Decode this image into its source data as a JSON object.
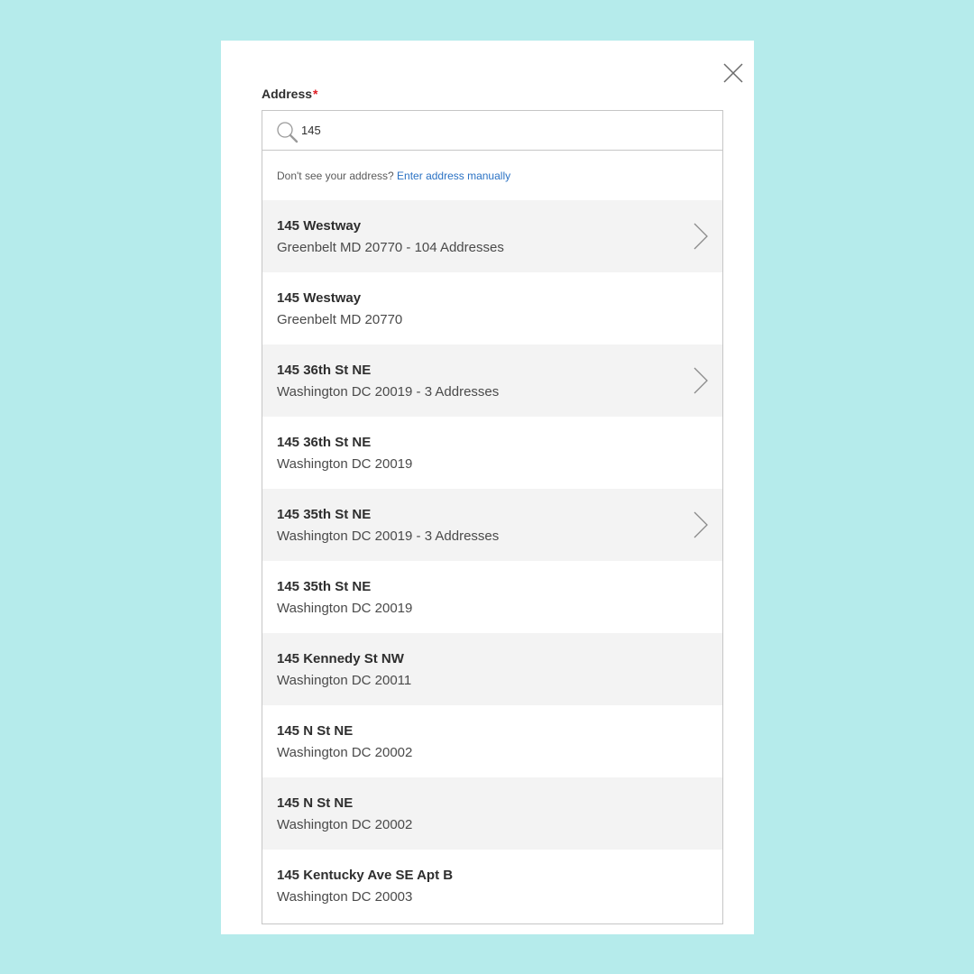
{
  "modal": {
    "field_label": "Address",
    "required_mark": "*",
    "search": {
      "icon": "search-icon",
      "value": "145"
    },
    "hint": {
      "text": "Don't see your address?",
      "link": "Enter address manually"
    },
    "colors": {
      "background": "#b5ebeb",
      "link": "#2a72c4",
      "required": "#de1c24",
      "row_shade": "#f3f3f3"
    },
    "results": [
      {
        "street": "145 Westway",
        "detail": "Greenbelt MD 20770 - 104 Addresses",
        "has_children": true
      },
      {
        "street": "145 Westway",
        "detail": "Greenbelt MD 20770",
        "has_children": false
      },
      {
        "street": "145 36th St NE",
        "detail": "Washington DC 20019 - 3 Addresses",
        "has_children": true
      },
      {
        "street": "145 36th St NE",
        "detail": "Washington DC 20019",
        "has_children": false
      },
      {
        "street": "145 35th St NE",
        "detail": "Washington DC 20019 - 3 Addresses",
        "has_children": true
      },
      {
        "street": "145 35th St NE",
        "detail": "Washington DC 20019",
        "has_children": false
      },
      {
        "street": "145 Kennedy St NW",
        "detail": "Washington DC 20011",
        "has_children": false
      },
      {
        "street": "145 N St NE",
        "detail": "Washington DC 20002",
        "has_children": false
      },
      {
        "street": "145 N St NE",
        "detail": "Washington DC 20002",
        "has_children": false
      },
      {
        "street": "145 Kentucky Ave SE Apt B",
        "detail": "Washington DC 20003",
        "has_children": false
      }
    ]
  }
}
